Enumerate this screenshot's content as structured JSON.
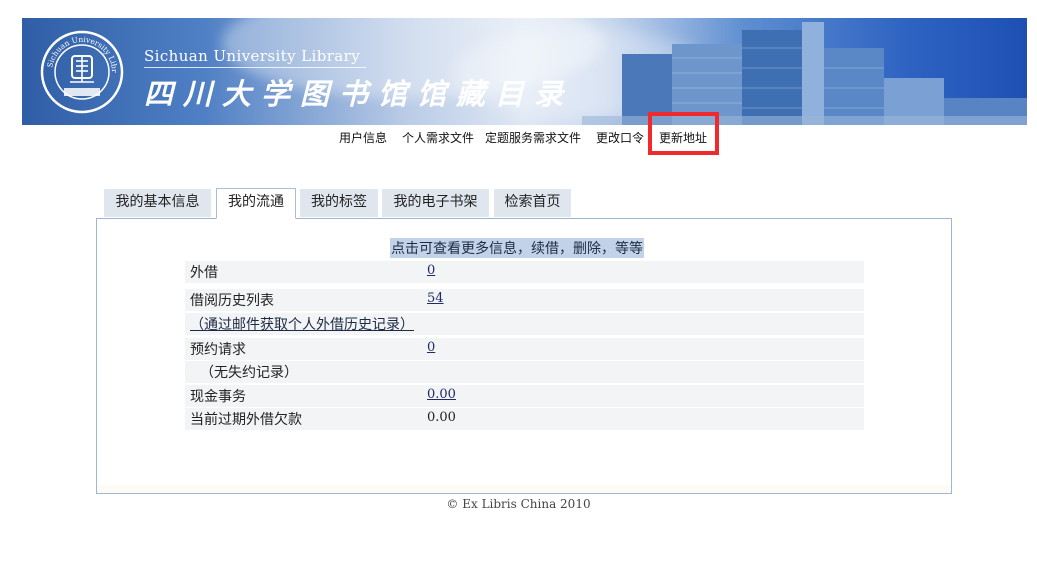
{
  "header": {
    "en_title": "Sichuan   University   Library",
    "cn_title": "四川大学图书馆馆藏目录"
  },
  "top_nav": [
    {
      "label": "用户信息"
    },
    {
      "label": "个人需求文件"
    },
    {
      "label": "定题服务需求文件"
    },
    {
      "label": "更改口令"
    },
    {
      "label": "更新地址"
    }
  ],
  "tabs": [
    {
      "label": "我的基本信息",
      "active": false
    },
    {
      "label": "我的流通",
      "active": true
    },
    {
      "label": "我的标签",
      "active": false
    },
    {
      "label": "我的电子书架",
      "active": false
    },
    {
      "label": "检索首页",
      "active": false
    }
  ],
  "panel": {
    "info_link": "点击可查看更多信息，续借，删除，等等",
    "rows": [
      {
        "label": "外借",
        "value": "0"
      },
      {
        "label": "借阅历史列表",
        "value": "54"
      },
      {
        "label": "（通过邮件获取个人外借历史记录）",
        "value": ""
      },
      {
        "label": "预约请求",
        "value": "0"
      },
      {
        "label": "（无失约记录）",
        "value": ""
      },
      {
        "label": "现金事务",
        "value": "0.00"
      },
      {
        "label": "当前过期外借欠款",
        "value": "0.00"
      }
    ]
  },
  "footer": "© Ex Libris China 2010",
  "colors": {
    "highlight": "#f0292d",
    "tab_bg": "#dfe6ee",
    "panel_border": "#9fb5d3",
    "row_bg": "#f2f4f6",
    "link_highlight_bg": "#c2d2e8"
  }
}
